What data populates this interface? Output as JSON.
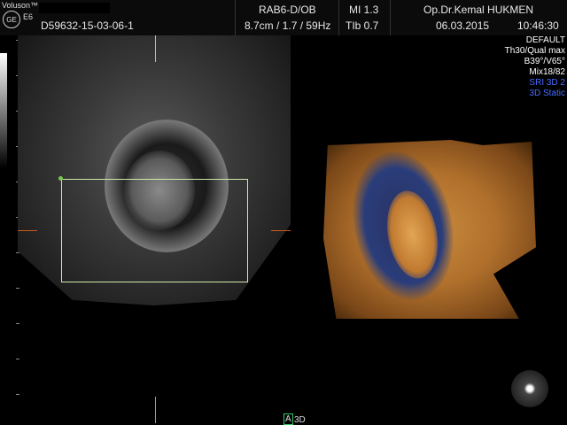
{
  "header": {
    "brand": "Voluson™",
    "logo_text": "GE",
    "model": "E6",
    "patient_id": "D59632-15-03-06-1",
    "probe": "RAB6-D/OB",
    "depth_freq": "8.7cm / 1.7 / 59Hz",
    "mi": "MI 1.3",
    "tib": "TIb 0.7",
    "physician": "Op.Dr.Kemal HUKMEN",
    "date": "06.03.2015",
    "time": "10:46:30"
  },
  "info_panel": {
    "preset": "DEFAULT",
    "quality": "Th30/Qual max",
    "angles": "B39°/V65°",
    "mix": "Mix18/82",
    "sri": "SRI 3D 2",
    "mode": "3D Static"
  },
  "bottom": {
    "view_a": "A",
    "view_3d": "3D"
  },
  "colors": {
    "sri": "#4a6bff",
    "mode": "#4a6bff",
    "roi": "#cfe8a8",
    "marker": "#c85a1a"
  }
}
